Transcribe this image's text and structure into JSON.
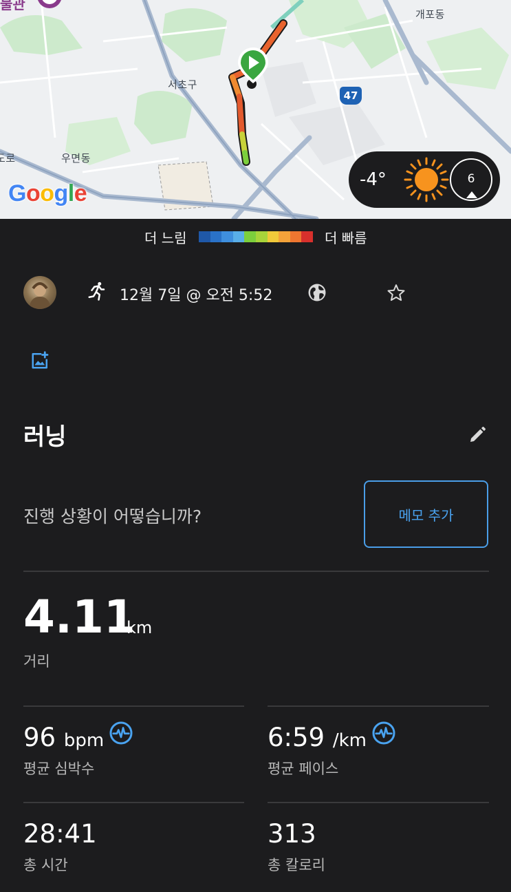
{
  "map": {
    "top_edge_label": "물관",
    "labels": {
      "gaepo": "개포동",
      "seocho": "서초구",
      "umyeon": "우면동",
      "ro": "도로"
    },
    "shield_number": "47",
    "google_logo": {
      "letters": [
        "G",
        "o",
        "o",
        "g",
        "l",
        "e"
      ],
      "colors": [
        "#4285F4",
        "#EA4335",
        "#FBBC05",
        "#4285F4",
        "#34A853",
        "#EA4335"
      ]
    },
    "weather": {
      "temperature": "-4°",
      "condition_icon": "sun-icon",
      "wind_speed": "6"
    }
  },
  "legend": {
    "slow": "더 느림",
    "fast": "더 빠름",
    "colors": [
      "#1f58a8",
      "#2a72c8",
      "#3f8fde",
      "#59aee8",
      "#7ccf3c",
      "#a8d43a",
      "#f0c93a",
      "#f3a23a",
      "#ef7630",
      "#d8302c"
    ]
  },
  "activity": {
    "avatar": "avatar",
    "type_icon": "running-icon",
    "datetime": "12월 7일 @ 오전 5:52",
    "privacy_icon": "globe-icon",
    "favorite_icon": "star-outline-icon",
    "add_photo_icon": "add-photo-icon",
    "title": "러닝",
    "edit_icon": "pencil-icon",
    "prompt": "진행 상황이 어떻습니까?",
    "memo_button": "메모 추가"
  },
  "stats": {
    "distance": {
      "value": "4.11",
      "unit": "km",
      "label": "거리"
    },
    "avg_hr": {
      "value": "96",
      "unit": "bpm",
      "label": "평균 심박수"
    },
    "avg_pace": {
      "value": "6:59",
      "unit": "/km",
      "label": "평균 페이스"
    },
    "total_time": {
      "value": "28:41",
      "label": "총 시간"
    },
    "calories": {
      "value": "313",
      "label": "총 칼로리"
    }
  },
  "colors": {
    "background": "#1c1c1e",
    "accent_blue": "#4aa3f0",
    "divider": "#3a3a3c"
  }
}
